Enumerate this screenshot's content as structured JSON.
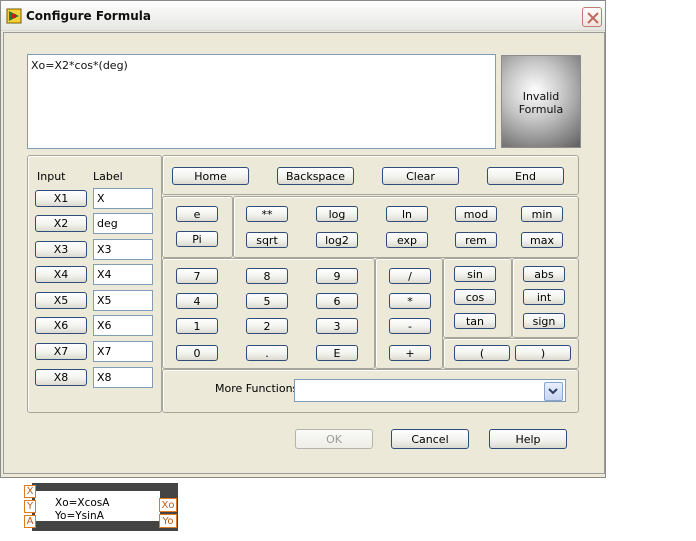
{
  "window": {
    "title": "Configure Formula"
  },
  "formula": {
    "text": "Xo=X2*cos*(deg)",
    "status": "Invalid\nFormula"
  },
  "inputs": {
    "input_header": "Input",
    "label_header": "Label",
    "rows": [
      {
        "button": "X1",
        "label": "X"
      },
      {
        "button": "X2",
        "label": "deg"
      },
      {
        "button": "X3",
        "label": "X3"
      },
      {
        "button": "X4",
        "label": "X4"
      },
      {
        "button": "X5",
        "label": "X5"
      },
      {
        "button": "X6",
        "label": "X6"
      },
      {
        "button": "X7",
        "label": "X7"
      },
      {
        "button": "X8",
        "label": "X8"
      }
    ]
  },
  "edit_buttons": [
    "Home",
    "Backspace",
    "Clear",
    "End"
  ],
  "constants": [
    "e",
    "Pi"
  ],
  "functions_top": [
    "**",
    "log",
    "ln",
    "mod",
    "min",
    "sqrt",
    "log2",
    "exp",
    "rem",
    "max"
  ],
  "digits": [
    "7",
    "8",
    "9",
    "4",
    "5",
    "6",
    "1",
    "2",
    "3",
    "0",
    ".",
    "E"
  ],
  "operators": [
    "/",
    "*",
    "-",
    "+"
  ],
  "trig": [
    "sin",
    "cos",
    "tan"
  ],
  "misc": [
    "abs",
    "int",
    "sign"
  ],
  "parens": [
    "(",
    ")"
  ],
  "more_functions": {
    "label": "More Functions",
    "value": ""
  },
  "dialog_buttons": {
    "ok": "OK",
    "cancel": "Cancel",
    "help": "Help",
    "ok_enabled": false
  },
  "block": {
    "inputs": [
      "X",
      "Y",
      "A"
    ],
    "outputs": [
      "Xo",
      "Yo"
    ],
    "text": "Xo=XcosA\nYo=YsinA"
  },
  "colors": {
    "window_bg": "#ece9d8",
    "button_border": "#2e4d7b",
    "terminal_orange": "#e07a1f"
  }
}
